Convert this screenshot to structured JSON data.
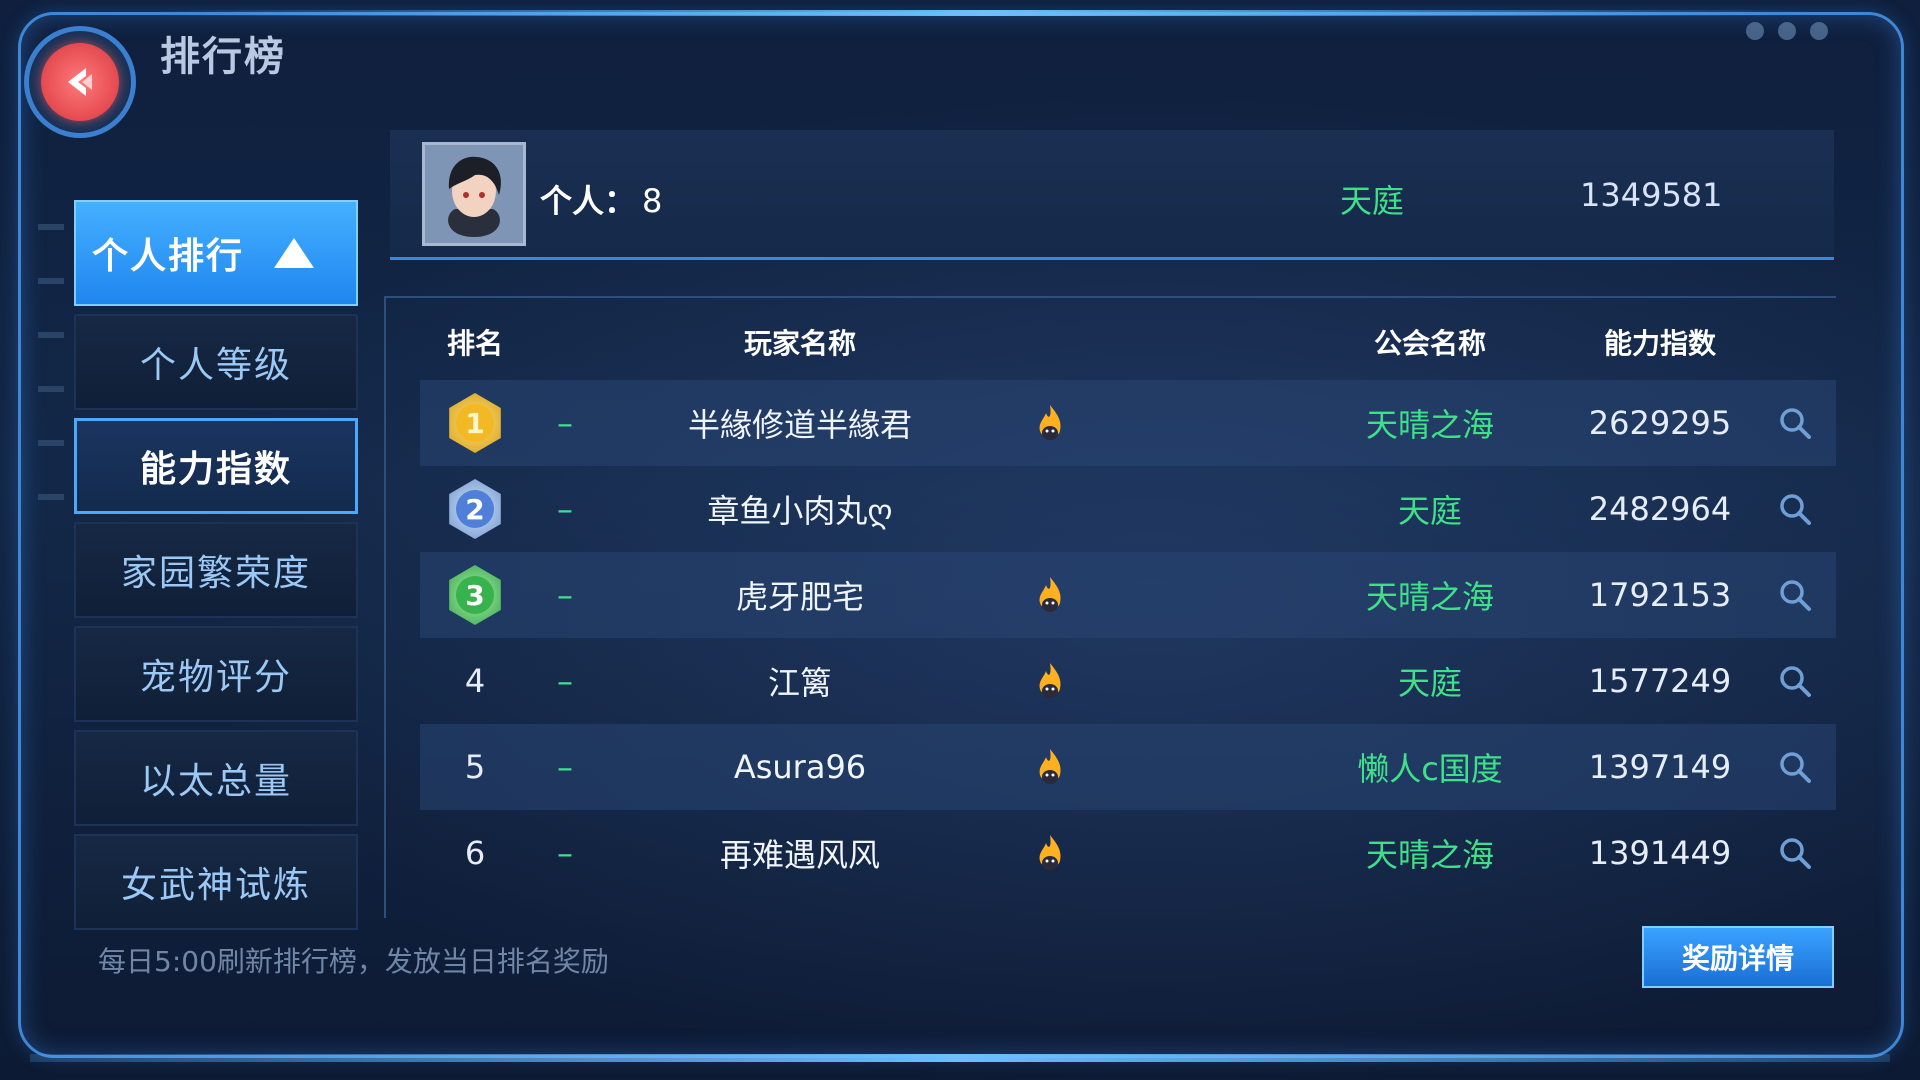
{
  "header": {
    "title": "排行榜"
  },
  "sidebar": {
    "items": [
      {
        "label": "个人排行",
        "state": "active"
      },
      {
        "label": "个人等级",
        "state": "normal"
      },
      {
        "label": "能力指数",
        "state": "selected"
      },
      {
        "label": "家园繁荣度",
        "state": "normal"
      },
      {
        "label": "宠物评分",
        "state": "normal"
      },
      {
        "label": "以太总量",
        "state": "normal"
      },
      {
        "label": "女武神试炼",
        "state": "normal"
      }
    ]
  },
  "my_rank": {
    "label": "个人：",
    "rank": "8",
    "guild": "天庭",
    "score": "1349581"
  },
  "table": {
    "columns": {
      "rank": "排名",
      "name": "玩家名称",
      "guild": "公会名称",
      "score": "能力指数"
    },
    "rows": [
      {
        "rank": "1",
        "trend": "–",
        "name": "半緣修道半緣君",
        "flame": true,
        "guild": "天晴之海",
        "score": "2629295"
      },
      {
        "rank": "2",
        "trend": "–",
        "name": "章鱼小肉丸ღ",
        "flame": false,
        "guild": "天庭",
        "score": "2482964"
      },
      {
        "rank": "3",
        "trend": "–",
        "name": "虎牙肥宅",
        "flame": true,
        "guild": "天晴之海",
        "score": "1792153"
      },
      {
        "rank": "4",
        "trend": "–",
        "name": "江篱",
        "flame": true,
        "guild": "天庭",
        "score": "1577249"
      },
      {
        "rank": "5",
        "trend": "–",
        "name": "Asura96",
        "flame": true,
        "guild": "懒人c国度",
        "score": "1397149"
      },
      {
        "rank": "6",
        "trend": "–",
        "name": "再难遇风风",
        "flame": true,
        "guild": "天晴之海",
        "score": "1391449"
      }
    ]
  },
  "footer": {
    "notice": "每日5:00刷新排行榜，发放当日排名奖励",
    "reward_button": "奖励详情"
  },
  "colors": {
    "accent": "#1f86f0",
    "guild_green": "#3fe08a",
    "gold": "#f2b924",
    "silver": "#4f7fd8",
    "bronze": "#38b24d"
  },
  "icons": {
    "back": "back-arrow-icon",
    "search": "magnifier-icon",
    "flame": "flame-icon"
  }
}
